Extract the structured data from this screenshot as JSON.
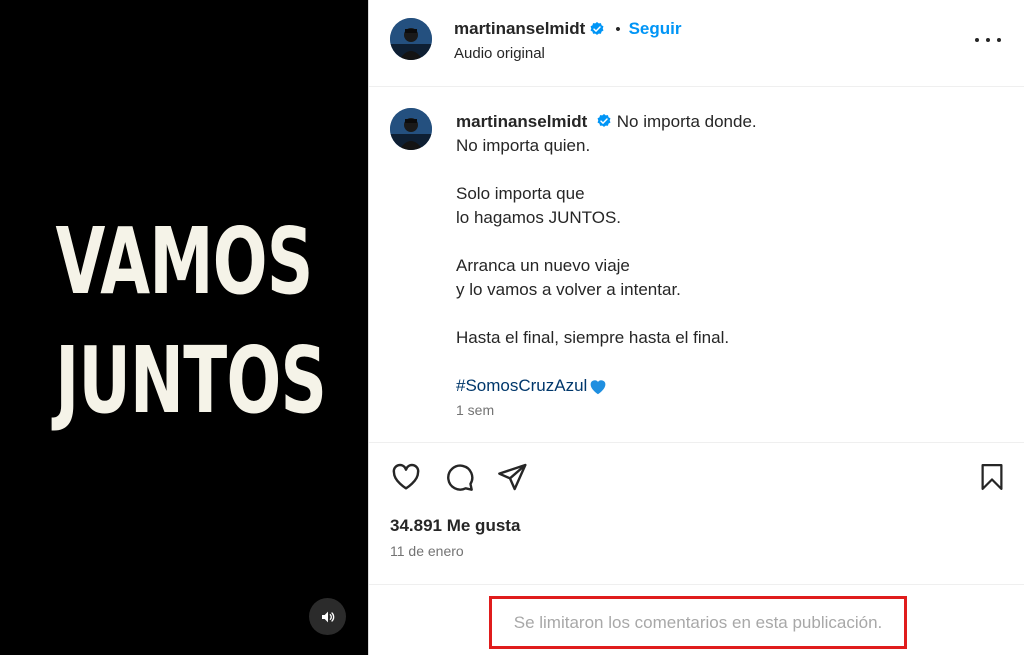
{
  "video": {
    "overlay_line_1": "VAMOS",
    "overlay_line_2": "JUNTOS",
    "mute_icon": "speaker-icon"
  },
  "header": {
    "username": "martinanselmidt",
    "verified_icon": "verified-badge-icon",
    "separator": "•",
    "follow_label": "Seguir",
    "audio_label": "Audio original",
    "more_icon": "more-options-icon"
  },
  "caption": {
    "username": "martinanselmidt",
    "lines": [
      "No importa donde.",
      "No importa quien.",
      "Solo importa que",
      "lo hagamos JUNTOS.",
      "Arranca un nuevo viaje",
      "y lo vamos a volver a intentar.",
      "Hasta el final, siempre hasta el final."
    ],
    "hashtag": "#SomosCruzAzul",
    "emoji_icon": "blue-heart-icon",
    "time_ago": "1 sem"
  },
  "actions": {
    "like_icon": "heart-icon",
    "comment_icon": "comment-icon",
    "share_icon": "share-icon",
    "save_icon": "bookmark-icon"
  },
  "stats": {
    "likes": "34.891 Me gusta",
    "date": "11 de enero"
  },
  "comments": {
    "limited_message": "Se limitaron los comentarios en esta publicación."
  },
  "colors": {
    "accent": "#0095f6",
    "hashtag": "#00376b",
    "verified": "#0095f6",
    "highlight_border": "#e01c1c",
    "video_text": "#f5f3e8"
  }
}
